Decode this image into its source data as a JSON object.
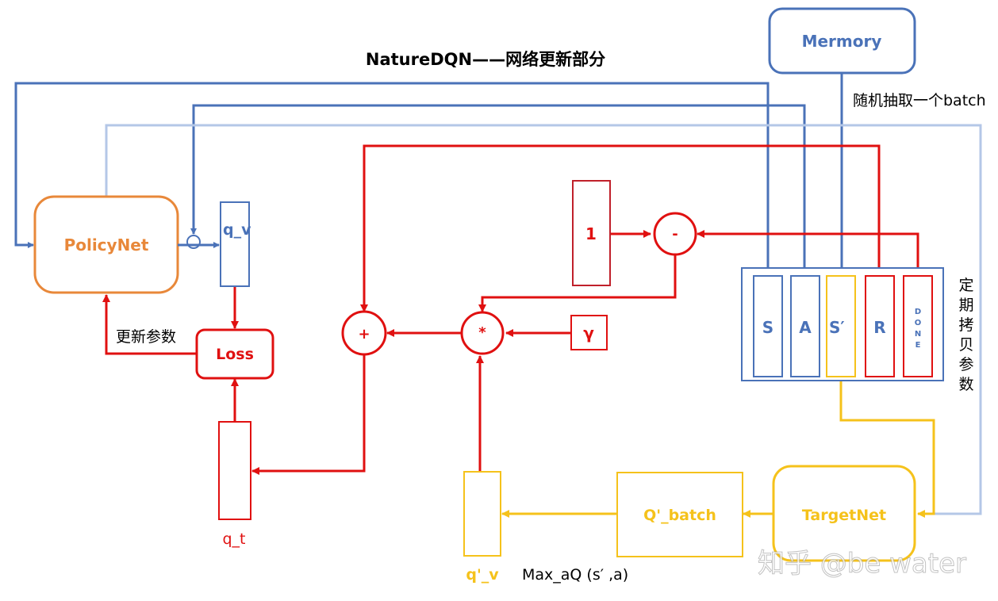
{
  "title": "NatureDQN——网络更新部分",
  "colors": {
    "blue": "#4a72b8",
    "light_blue": "#b4c7e7",
    "red": "#e01010",
    "orange": "#e8883a",
    "yellow": "#f5c21b",
    "text": "#000000"
  },
  "nodes": {
    "memory": "Mermory",
    "policy_net": "PolicyNet",
    "target_net": "TargetNet",
    "q_v": "q_v",
    "loss": "Loss",
    "q_t": "q_t",
    "one": "1",
    "minus": "-",
    "plus": "+",
    "times": "*",
    "gamma": "γ",
    "q_batch": "Q'_batch",
    "q_prime_v": "q'_v"
  },
  "batch": {
    "s": "S",
    "a": "A",
    "s_prime": "S′",
    "r": "R",
    "done_letters": [
      "D",
      "O",
      "N",
      "E"
    ]
  },
  "labels": {
    "sample_batch": "随机抽取一个batch",
    "update_params": "更新参数",
    "copy_params_chars": [
      "定",
      "期",
      "拷",
      "贝",
      "参",
      "数"
    ],
    "max_aq": "Max_aQ (s′  ,a)"
  },
  "watermark": "知乎 @be water"
}
